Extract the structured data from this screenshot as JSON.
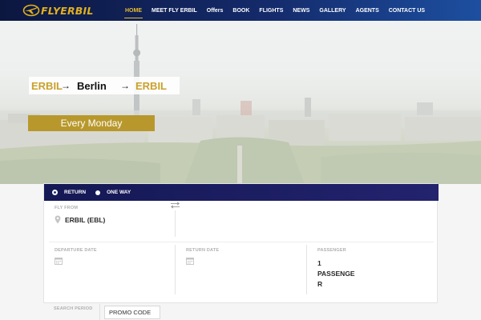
{
  "brand": {
    "logo_text": "FLYERBIL"
  },
  "nav": {
    "items": [
      {
        "label": "HOME",
        "active": true
      },
      {
        "label": "MEET FLY ERBIL"
      },
      {
        "label": "Offers"
      },
      {
        "label": "BOOK"
      },
      {
        "label": "FLIGHTS"
      },
      {
        "label": "NEWS"
      },
      {
        "label": "GALLERY"
      },
      {
        "label": "AGENTS"
      },
      {
        "label": "CONTACT US"
      }
    ]
  },
  "hero": {
    "route_from": "ERBIL",
    "route_arrow": "→",
    "route_mid": "Berlin",
    "route_to": "ERBIL",
    "schedule": "Every Monday"
  },
  "search": {
    "trip_types": [
      "RETURN",
      "ONE WAY"
    ],
    "selected_trip_type": "RETURN",
    "fly_from_label": "FLY FROM",
    "fly_from_value": "ERBIL (EBL)",
    "departure_label": "DEPARTURE DATE",
    "return_label": "RETURN DATE",
    "passenger_label": "PASSENGER",
    "passenger_lines": [
      "1",
      "PASSENGE",
      "R"
    ],
    "search_period_label": "SEARCH PERIOD",
    "promo_placeholder": "PROMO CODE"
  },
  "colors": {
    "nav_start": "#0c1740",
    "nav_end": "#1d4fa0",
    "accent_gold": "#c9a12a",
    "trip_bar": "#141854"
  }
}
